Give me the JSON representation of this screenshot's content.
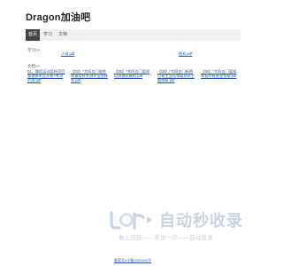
{
  "site": {
    "title": "Dragon加油吧"
  },
  "nav": {
    "tabs": [
      {
        "label": "首页"
      },
      {
        "label": "学习"
      },
      {
        "label": "文档"
      }
    ]
  },
  "sections": [
    {
      "label": "学习>>",
      "links": [
        "小说.pdf",
        "随机.pdf"
      ]
    },
    {
      "label": "文档>>",
      "links": [
        "01、舞蹈培训奖杯项目管理体系设计和+考试范围.pdf",
        "【03】^大四五门软件和通用技术测评全国排名.pdf",
        "【05】^大四五门篮球培训理论模拟.pdf",
        "【05】^大四五门新两位有工业化等级测试主题等级.pdf",
        "【06】^大四五门篮球等复的有感受等级.pdf"
      ]
    }
  ],
  "watermark": {
    "title": "自动秒收录",
    "subtitle": "做上链接——来访一次——自动收录"
  },
  "footer": {
    "text": "备案号ICP备2023000号"
  },
  "colors": {
    "link": "#2255bb",
    "nav_active": "#444444",
    "nav_bg": "#f0f0f0",
    "watermark": "#c9d3e2"
  }
}
